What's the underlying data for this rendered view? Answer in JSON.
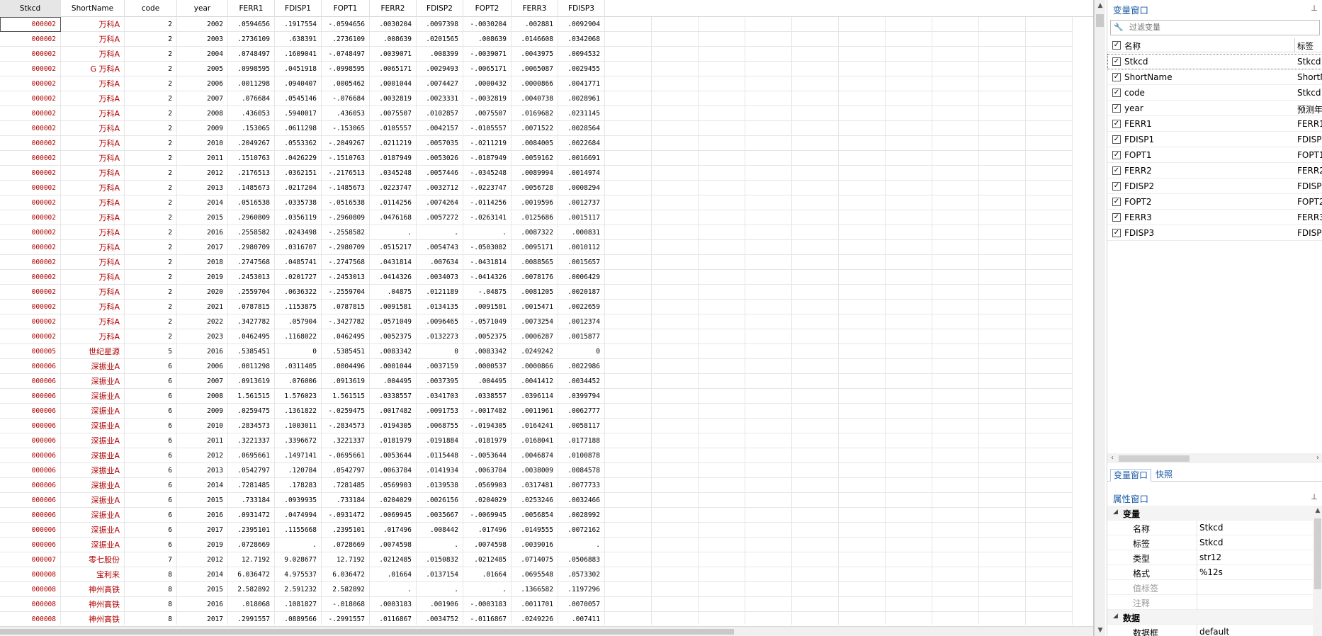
{
  "grid": {
    "columns": [
      "Stkcd",
      "ShortName",
      "code",
      "year",
      "FERR1",
      "FDISP1",
      "FOPT1",
      "FERR2",
      "FDISP2",
      "FOPT2",
      "FERR3",
      "FDISP3"
    ],
    "rows": [
      [
        "000002",
        "万科A",
        "2",
        "2002",
        ".0594656",
        ".1917554",
        "-.0594656",
        ".0030204",
        ".0097398",
        "-.0030204",
        ".002881",
        ".0092904"
      ],
      [
        "000002",
        "万科A",
        "2",
        "2003",
        ".2736109",
        ".638391",
        ".2736109",
        ".008639",
        ".0201565",
        ".008639",
        ".0146608",
        ".0342068"
      ],
      [
        "000002",
        "万科A",
        "2",
        "2004",
        ".0748497",
        ".1609041",
        "-.0748497",
        ".0039071",
        ".008399",
        "-.0039071",
        ".0043975",
        ".0094532"
      ],
      [
        "000002",
        "G 万科A",
        "2",
        "2005",
        ".0998595",
        ".0451918",
        "-.0998595",
        ".0065171",
        ".0029493",
        "-.0065171",
        ".0065087",
        ".0029455"
      ],
      [
        "000002",
        "万科A",
        "2",
        "2006",
        ".0011298",
        ".0940407",
        ".0005462",
        ".0001044",
        ".0074427",
        ".0000432",
        ".0000866",
        ".0041771"
      ],
      [
        "000002",
        "万科A",
        "2",
        "2007",
        ".076684",
        ".0545146",
        "-.076684",
        ".0032819",
        ".0023331",
        "-.0032819",
        ".0040738",
        ".0028961"
      ],
      [
        "000002",
        "万科A",
        "2",
        "2008",
        ".436053",
        ".5940017",
        ".436053",
        ".0075507",
        ".0102857",
        ".0075507",
        ".0169682",
        ".0231145"
      ],
      [
        "000002",
        "万科A",
        "2",
        "2009",
        ".153065",
        ".0611298",
        "-.153065",
        ".0105557",
        ".0042157",
        "-.0105557",
        ".0071522",
        ".0028564"
      ],
      [
        "000002",
        "万科A",
        "2",
        "2010",
        ".2049267",
        ".0553362",
        "-.2049267",
        ".0211219",
        ".0057035",
        "-.0211219",
        ".0084005",
        ".0022684"
      ],
      [
        "000002",
        "万科A",
        "2",
        "2011",
        ".1510763",
        ".0426229",
        "-.1510763",
        ".0187949",
        ".0053026",
        "-.0187949",
        ".0059162",
        ".0016691"
      ],
      [
        "000002",
        "万科A",
        "2",
        "2012",
        ".2176513",
        ".0362151",
        "-.2176513",
        ".0345248",
        ".0057446",
        "-.0345248",
        ".0089994",
        ".0014974"
      ],
      [
        "000002",
        "万科A",
        "2",
        "2013",
        ".1485673",
        ".0217204",
        "-.1485673",
        ".0223747",
        ".0032712",
        "-.0223747",
        ".0056728",
        ".0008294"
      ],
      [
        "000002",
        "万科A",
        "2",
        "2014",
        ".0516538",
        ".0335738",
        "-.0516538",
        ".0114256",
        ".0074264",
        "-.0114256",
        ".0019596",
        ".0012737"
      ],
      [
        "000002",
        "万科A",
        "2",
        "2015",
        ".2960809",
        ".0356119",
        "-.2960809",
        ".0476168",
        ".0057272",
        "-.0263141",
        ".0125686",
        ".0015117"
      ],
      [
        "000002",
        "万科A",
        "2",
        "2016",
        ".2558582",
        ".0243498",
        "-.2558582",
        ".",
        ".",
        ".",
        ".0087322",
        ".000831"
      ],
      [
        "000002",
        "万科A",
        "2",
        "2017",
        ".2980709",
        ".0316707",
        "-.2980709",
        ".0515217",
        ".0054743",
        "-.0503082",
        ".0095171",
        ".0010112"
      ],
      [
        "000002",
        "万科A",
        "2",
        "2018",
        ".2747568",
        ".0485741",
        "-.2747568",
        ".0431814",
        ".007634",
        "-.0431814",
        ".0088565",
        ".0015657"
      ],
      [
        "000002",
        "万科A",
        "2",
        "2019",
        ".2453013",
        ".0201727",
        "-.2453013",
        ".0414326",
        ".0034073",
        "-.0414326",
        ".0078176",
        ".0006429"
      ],
      [
        "000002",
        "万科A",
        "2",
        "2020",
        ".2559704",
        ".0636322",
        "-.2559704",
        ".04875",
        ".0121189",
        "-.04875",
        ".0081205",
        ".0020187"
      ],
      [
        "000002",
        "万科A",
        "2",
        "2021",
        ".0787815",
        ".1153875",
        ".0787815",
        ".0091581",
        ".0134135",
        ".0091581",
        ".0015471",
        ".0022659"
      ],
      [
        "000002",
        "万科A",
        "2",
        "2022",
        ".3427782",
        ".057904",
        "-.3427782",
        ".0571049",
        ".0096465",
        "-.0571049",
        ".0073254",
        ".0012374"
      ],
      [
        "000002",
        "万科A",
        "2",
        "2023",
        ".0462495",
        ".1168022",
        ".0462495",
        ".0052375",
        ".0132273",
        ".0052375",
        ".0006287",
        ".0015877"
      ],
      [
        "000005",
        "世纪星源",
        "5",
        "2016",
        ".5385451",
        "0",
        ".5385451",
        ".0083342",
        "0",
        ".0083342",
        ".0249242",
        "0"
      ],
      [
        "000006",
        "深振业A",
        "6",
        "2006",
        ".0011298",
        ".0311405",
        ".0004496",
        ".0001044",
        ".0037159",
        ".0000537",
        ".0000866",
        ".0022986"
      ],
      [
        "000006",
        "深振业A",
        "6",
        "2007",
        ".0913619",
        ".076006",
        ".0913619",
        ".004495",
        ".0037395",
        ".004495",
        ".0041412",
        ".0034452"
      ],
      [
        "000006",
        "深振业A",
        "6",
        "2008",
        "1.561515",
        "1.576023",
        "1.561515",
        ".0338557",
        ".0341703",
        ".0338557",
        ".0396114",
        ".0399794"
      ],
      [
        "000006",
        "深振业A",
        "6",
        "2009",
        ".0259475",
        ".1361822",
        "-.0259475",
        ".0017482",
        ".0091753",
        "-.0017482",
        ".0011961",
        ".0062777"
      ],
      [
        "000006",
        "深振业A",
        "6",
        "2010",
        ".2834573",
        ".1003011",
        "-.2834573",
        ".0194305",
        ".0068755",
        "-.0194305",
        ".0164241",
        ".0058117"
      ],
      [
        "000006",
        "深振业A",
        "6",
        "2011",
        ".3221337",
        ".3396672",
        ".3221337",
        ".0181979",
        ".0191884",
        ".0181979",
        ".0168041",
        ".0177188"
      ],
      [
        "000006",
        "深振业A",
        "6",
        "2012",
        ".0695661",
        ".1497141",
        "-.0695661",
        ".0053644",
        ".0115448",
        "-.0053644",
        ".0046874",
        ".0100878"
      ],
      [
        "000006",
        "深振业A",
        "6",
        "2013",
        ".0542797",
        ".120784",
        ".0542797",
        ".0063784",
        ".0141934",
        ".0063784",
        ".0038009",
        ".0084578"
      ],
      [
        "000006",
        "深振业A",
        "6",
        "2014",
        ".7281485",
        ".178283",
        ".7281485",
        ".0569903",
        ".0139538",
        ".0569903",
        ".0317481",
        ".0077733"
      ],
      [
        "000006",
        "深振业A",
        "6",
        "2015",
        ".733184",
        ".0939935",
        ".733184",
        ".0204029",
        ".0026156",
        ".0204029",
        ".0253246",
        ".0032466"
      ],
      [
        "000006",
        "深振业A",
        "6",
        "2016",
        ".0931472",
        ".0474994",
        "-.0931472",
        ".0069945",
        ".0035667",
        "-.0069945",
        ".0056854",
        ".0028992"
      ],
      [
        "000006",
        "深振业A",
        "6",
        "2017",
        ".2395101",
        ".1155668",
        ".2395101",
        ".017496",
        ".008442",
        ".017496",
        ".0149555",
        ".0072162"
      ],
      [
        "000006",
        "深振业A",
        "6",
        "2019",
        ".0728669",
        ".",
        ".0728669",
        ".0074598",
        ".",
        ".0074598",
        ".0039016",
        "."
      ],
      [
        "000007",
        "零七股份",
        "7",
        "2012",
        "12.7192",
        "9.028677",
        "12.7192",
        ".0212485",
        ".0150832",
        ".0212485",
        ".0714075",
        ".0506883"
      ],
      [
        "000008",
        "宝利来",
        "8",
        "2014",
        "6.036472",
        "4.975537",
        "6.036472",
        ".01664",
        ".0137154",
        ".01664",
        ".0695548",
        ".0573302"
      ],
      [
        "000008",
        "神州高铁",
        "8",
        "2015",
        "2.582892",
        "2.591232",
        "2.582892",
        ".",
        ".",
        ".",
        ".1366582",
        ".1197296"
      ],
      [
        "000008",
        "神州高铁",
        "8",
        "2016",
        ".018068",
        ".1081827",
        "-.018068",
        ".0003183",
        ".001906",
        "-.0003183",
        ".0011701",
        ".0070057"
      ],
      [
        "000008",
        "神州高铁",
        "8",
        "2017",
        ".2991557",
        ".0889566",
        "-.2991557",
        ".0116867",
        ".0034752",
        "-.0116867",
        ".0249226",
        ".007411"
      ]
    ]
  },
  "variables_panel": {
    "title": "变量窗口",
    "filter_placeholder": "过滤变量",
    "col_name": "名称",
    "col_label": "标签",
    "items": [
      {
        "name": "Stkcd",
        "label": "Stkcd"
      },
      {
        "name": "ShortName",
        "label": "ShortN"
      },
      {
        "name": "code",
        "label": "Stkcd"
      },
      {
        "name": "year",
        "label": "预测年"
      },
      {
        "name": "FERR1",
        "label": "FERR1"
      },
      {
        "name": "FDISP1",
        "label": "FDISP"
      },
      {
        "name": "FOPT1",
        "label": "FOPT1"
      },
      {
        "name": "FERR2",
        "label": "FERR2"
      },
      {
        "name": "FDISP2",
        "label": "FDISP"
      },
      {
        "name": "FOPT2",
        "label": "FOPT2"
      },
      {
        "name": "FERR3",
        "label": "FERR3"
      },
      {
        "name": "FDISP3",
        "label": "FDISP"
      }
    ],
    "tabs": [
      "变量窗口",
      "快照"
    ]
  },
  "properties_panel": {
    "title": "属性窗口",
    "rows": [
      {
        "key": "变量",
        "value": "",
        "section": true
      },
      {
        "key": "名称",
        "value": "Stkcd"
      },
      {
        "key": "标签",
        "value": "Stkcd"
      },
      {
        "key": "类型",
        "value": "str12"
      },
      {
        "key": "格式",
        "value": "%12s"
      },
      {
        "key": "值标签",
        "value": "",
        "muted": true
      },
      {
        "key": "注释",
        "value": "",
        "muted": true
      },
      {
        "key": "数据",
        "value": "",
        "section": true
      },
      {
        "key": "数据框",
        "value": "default"
      }
    ]
  },
  "icons": {
    "pin": "pin-icon",
    "wrench": "wrench-icon",
    "check": "checkbox-icon"
  },
  "colors": {
    "string_text": "#b00000",
    "panel_title": "#1a5aa6"
  }
}
